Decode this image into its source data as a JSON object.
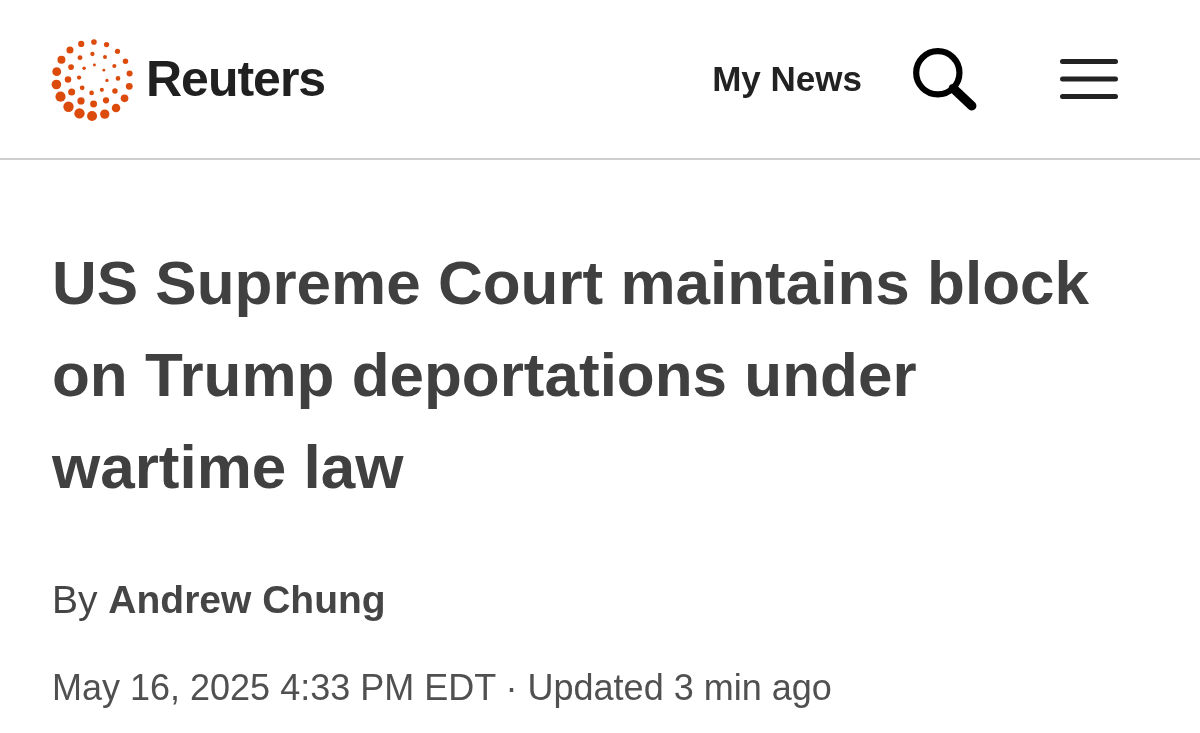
{
  "header": {
    "logo_text": "Reuters",
    "nav_link": "My News"
  },
  "article": {
    "headline": "US Supreme Court maintains block on Trump deportations under wartime law",
    "byline": "By **Andrew Chung**",
    "dateline": "May 16, 2025 4:33 PM EDT · Updated 3 min ago"
  }
}
